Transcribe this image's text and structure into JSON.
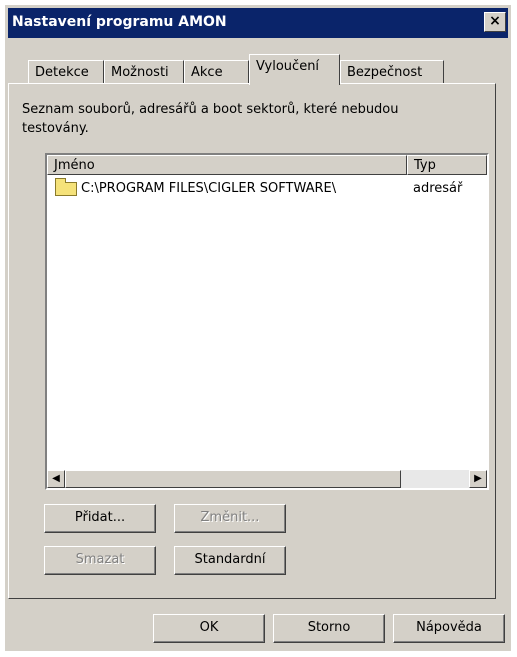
{
  "window": {
    "title": "Nastavení programu AMON",
    "close_label": "×"
  },
  "tabs": [
    {
      "label": "Detekce"
    },
    {
      "label": "Možnosti"
    },
    {
      "label": "Akce"
    },
    {
      "label": "Vyloučení",
      "active": true
    },
    {
      "label": "Bezpečnost"
    }
  ],
  "description": "Seznam souborů, adresářů a boot sektorů, které nebudou testovány.",
  "list": {
    "columns": [
      "Jméno",
      "Typ"
    ],
    "rows": [
      {
        "name": "C:\\PROGRAM FILES\\CIGLER SOFTWARE\\",
        "type": "adresář",
        "icon": "folder-icon"
      }
    ]
  },
  "buttons": {
    "add": "Přidat...",
    "edit": "Změnit...",
    "delete": "Smazat",
    "standard": "Standardní",
    "ok": "OK",
    "cancel": "Storno",
    "help": "Nápověda"
  }
}
